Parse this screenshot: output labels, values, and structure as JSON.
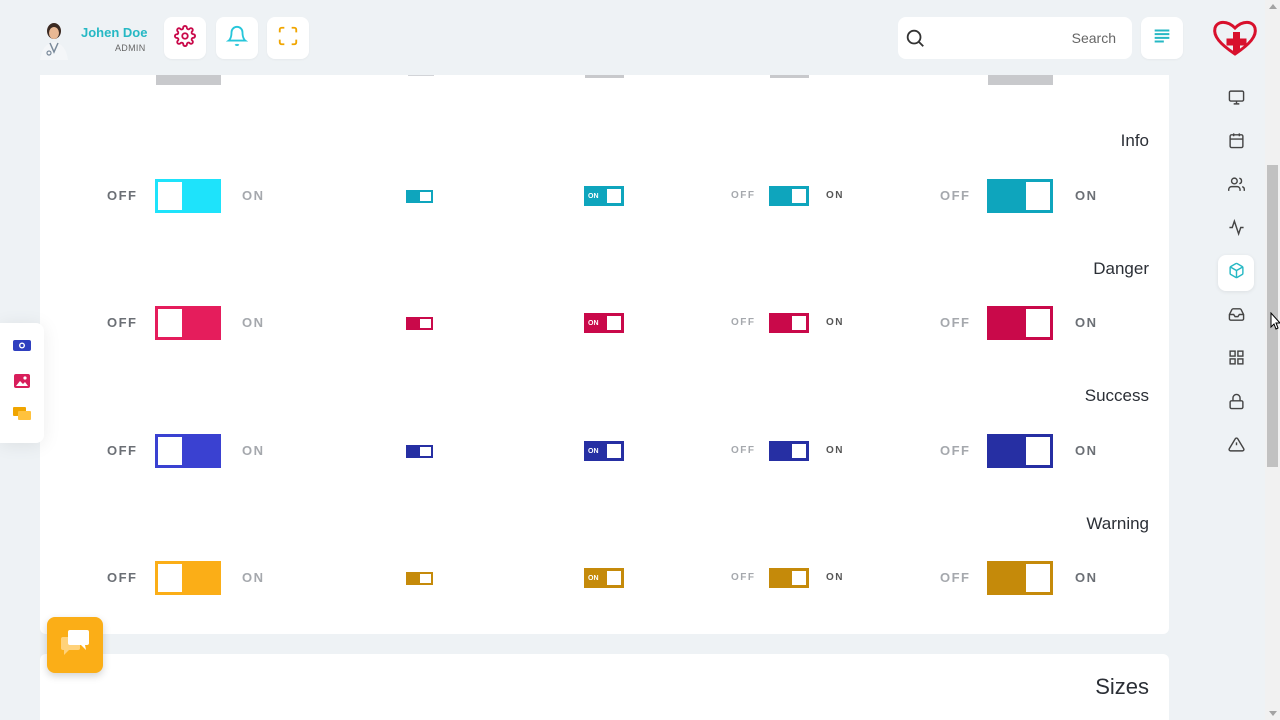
{
  "header": {
    "user_name": "Johen Doe",
    "user_role": "ADMIN",
    "search_placeholder": "Search",
    "icons": [
      "gear-icon",
      "bell-icon",
      "fullscreen-icon",
      "search-icon",
      "menu-lines-icon"
    ],
    "brand_logo": "heart-cross-logo"
  },
  "sidebar": {
    "items": [
      "monitor-icon",
      "calendar-icon",
      "users-icon",
      "activity-icon",
      "cube-icon",
      "inbox-icon",
      "grid-icon",
      "lock-icon",
      "alert-icon"
    ],
    "active": "cube-icon"
  },
  "toggle_labels": {
    "off": "OFF",
    "on": "ON",
    "inner_on": "ON"
  },
  "groups": [
    {
      "label": "Info",
      "color": "#0ea5bd",
      "light_color": "#1ee3fb"
    },
    {
      "label": "Danger",
      "color": "#c9094a",
      "light_color": "#e51d5c"
    },
    {
      "label": "Success",
      "color": "#262fa3",
      "light_color": "#3a41d1"
    },
    {
      "label": "Warning",
      "color": "#c58a0a",
      "light_color": "#fbae17"
    }
  ],
  "section2": {
    "title": "Sizes"
  },
  "floating": {
    "items": [
      "camera-icon",
      "image-icon",
      "chat-icon"
    ]
  },
  "colors": {
    "accent": "#26b8c4",
    "page_bg": "#eef2f5"
  }
}
